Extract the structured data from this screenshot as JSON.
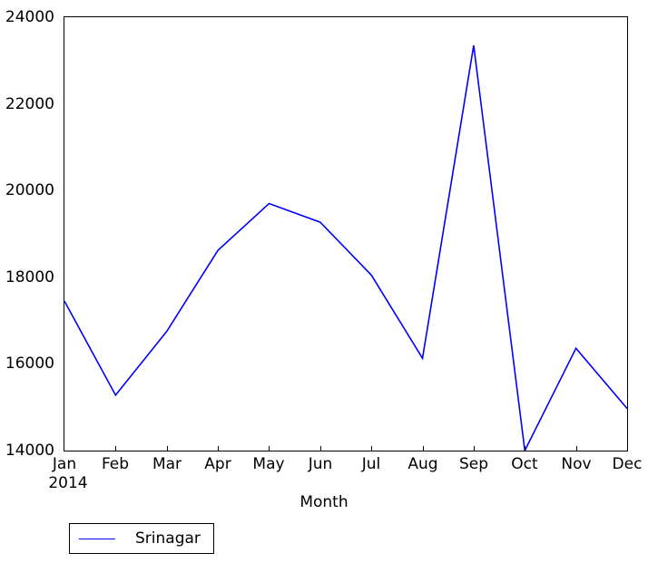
{
  "chart_data": {
    "type": "line",
    "title": "",
    "xlabel": "Month",
    "ylabel": "",
    "x_offset_text": "2014",
    "categories": [
      "Jan",
      "Feb",
      "Mar",
      "Apr",
      "May",
      "Jun",
      "Jul",
      "Aug",
      "Sep",
      "Oct",
      "Nov",
      "Dec"
    ],
    "series": [
      {
        "name": "Srinagar",
        "color": "#0000ff",
        "values": [
          17450,
          15280,
          16750,
          18620,
          19700,
          19270,
          18050,
          16130,
          23350,
          14000,
          16360,
          14970
        ]
      }
    ],
    "ylim": [
      14000,
      24000
    ],
    "yticks": [
      14000,
      16000,
      18000,
      20000,
      22000,
      24000
    ],
    "ytick_labels": [
      "14000",
      "16000",
      "18000",
      "20000",
      "22000",
      "24000"
    ],
    "grid": false,
    "legend_position": "below-left",
    "legend_entries": [
      "Srinagar"
    ]
  },
  "legend": {
    "items": [
      {
        "label": "Srinagar",
        "color": "#0000ff"
      }
    ]
  },
  "axes": {
    "x_label": "Month",
    "x_offset": "2014"
  }
}
